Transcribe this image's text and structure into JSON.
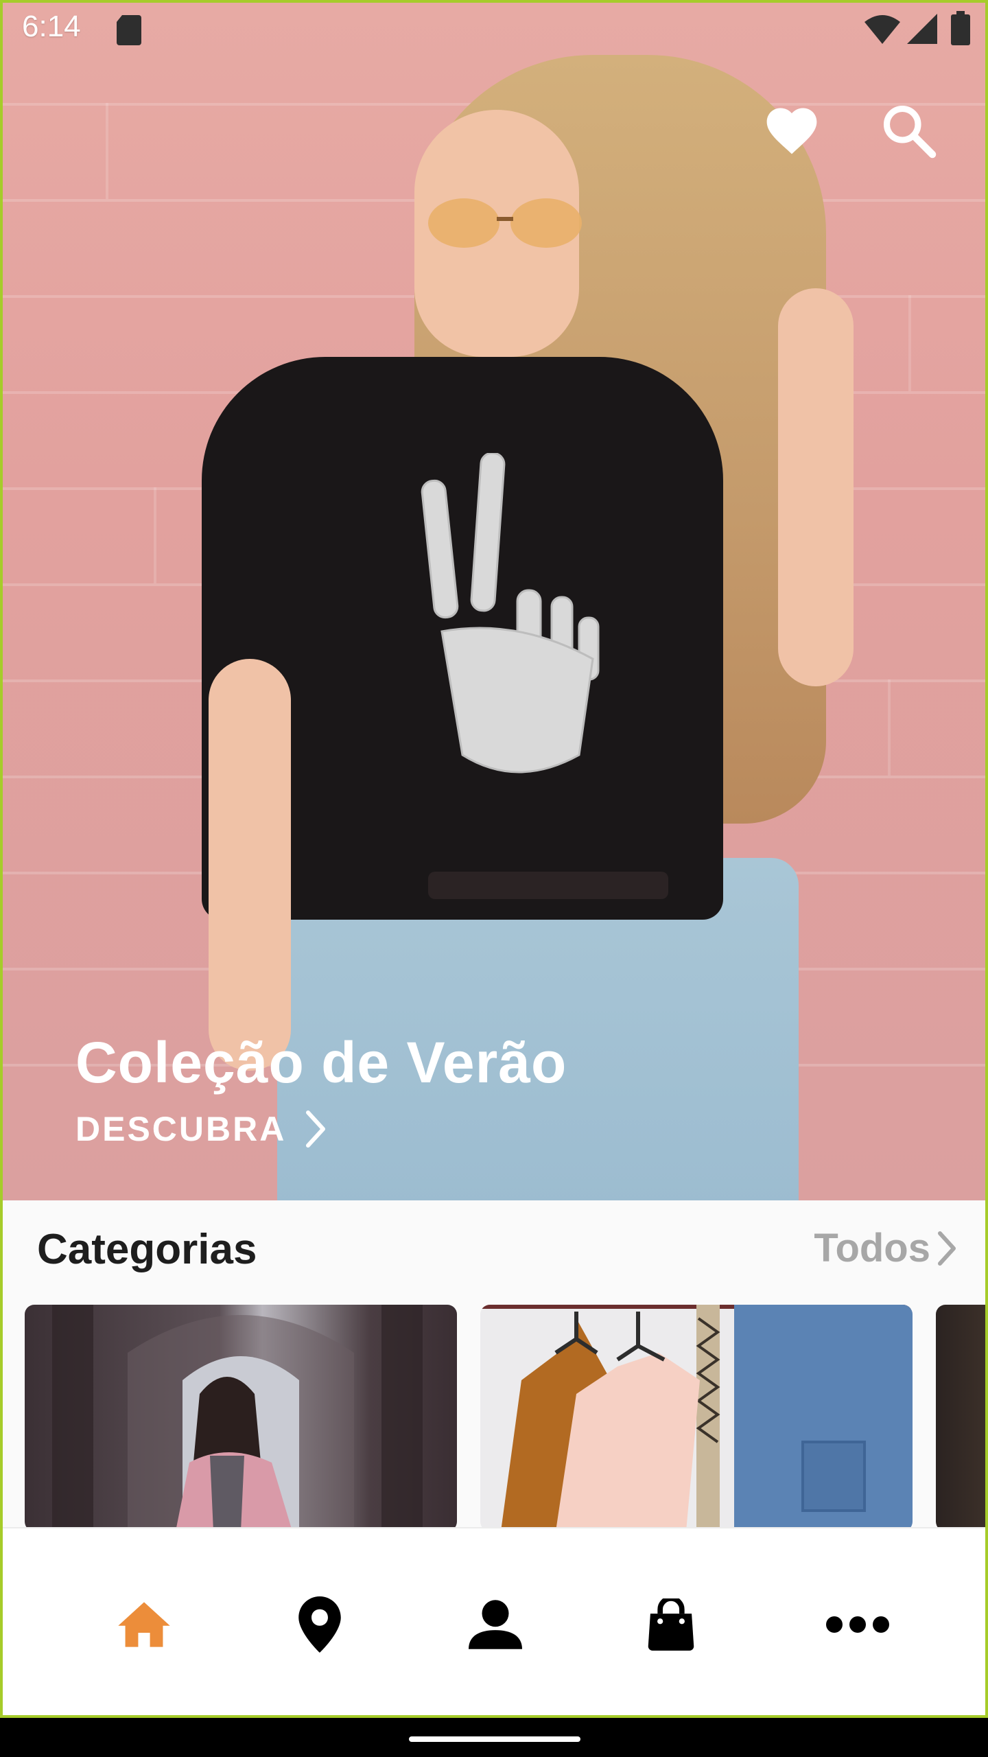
{
  "status_bar": {
    "time": "6:14"
  },
  "hero": {
    "title": "Coleção de Verão",
    "cta_label": "DESCUBRA",
    "icons": [
      "heart-icon",
      "search-icon"
    ]
  },
  "categories": {
    "title": "Categorias",
    "see_all_label": "Todos",
    "cards": [
      {
        "name": "category-card-1",
        "image": "woman-in-corridor"
      },
      {
        "name": "category-card-2",
        "image": "clothes-on-hangers"
      },
      {
        "name": "category-card-3",
        "image": "partial-card"
      }
    ]
  },
  "bottom_nav": {
    "items": [
      {
        "name": "home",
        "icon": "home-icon",
        "active": true
      },
      {
        "name": "location",
        "icon": "location-pin-icon",
        "active": false
      },
      {
        "name": "profile",
        "icon": "person-icon",
        "active": false
      },
      {
        "name": "bag",
        "icon": "shopping-bag-icon",
        "active": false
      },
      {
        "name": "more",
        "icon": "more-dots-icon",
        "active": false
      }
    ]
  },
  "colors": {
    "accent": "#ec8d3a",
    "nav_inactive": "#000000",
    "frame": "#a6cc2a",
    "category_muted": "#a7a7a7"
  }
}
